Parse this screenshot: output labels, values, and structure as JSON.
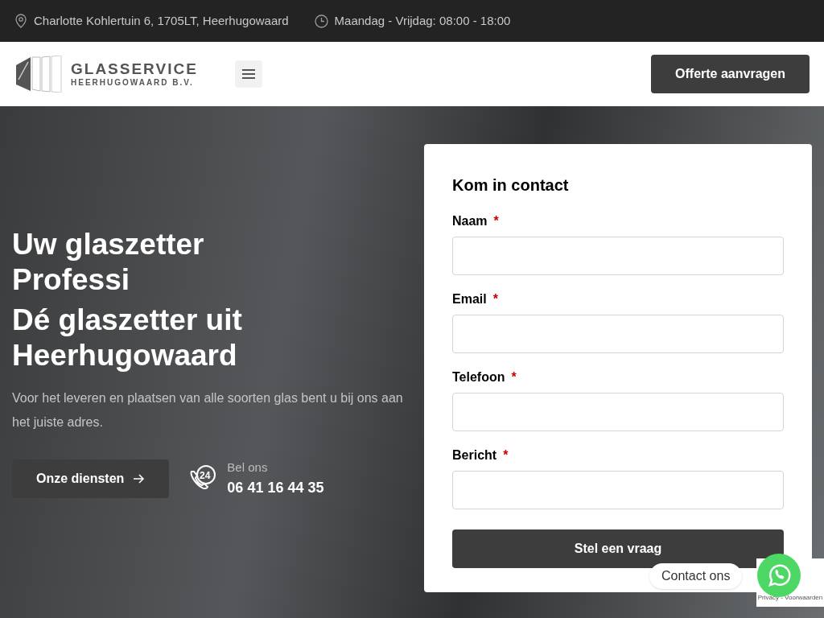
{
  "topbar": {
    "address": "Charlotte Kohlertuin 6, 1705LT, Heerhugowaard",
    "hours": "Maandag - Vrijdag: 08:00 - 18:00"
  },
  "header": {
    "logo_title": "GLASSERVICE",
    "logo_subtitle": "HEERHUGOWAARD B.V.",
    "cta": "Offerte aanvragen"
  },
  "hero": {
    "heading": "Uw glaszetter Professi",
    "subheading": "Dé glaszetter uit Heerhugowaard",
    "text": "Voor het leveren en plaatsen van alle soorten glas bent u bij ons aan het juiste adres.",
    "button": "Onze diensten",
    "call_label": "Bel ons",
    "call_badge": "24",
    "phone": "06 41 16 44 35"
  },
  "form": {
    "title": "Kom in contact",
    "fields": [
      {
        "label": "Naam",
        "required": true,
        "kind": "input"
      },
      {
        "label": "Email",
        "required": true,
        "kind": "input"
      },
      {
        "label": "Telefoon",
        "required": true,
        "kind": "input"
      },
      {
        "label": "Bericht",
        "required": true,
        "kind": "input"
      }
    ],
    "required_mark": "*",
    "submit": "Stel een vraag"
  },
  "chat": {
    "label": "Contact ons"
  },
  "recaptcha": {
    "text": "Privacy - Voorwaarden"
  }
}
